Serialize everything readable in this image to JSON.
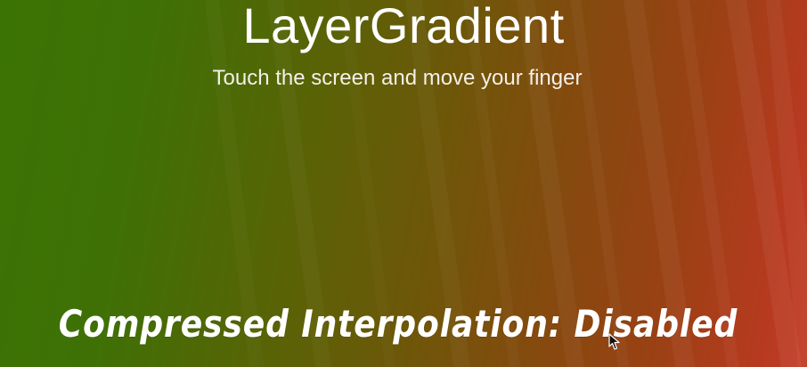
{
  "app": {
    "title": "LayerGradient",
    "instruction": "Touch the screen and move your finger",
    "status_text": "Compressed Interpolation: Disabled"
  },
  "colors": {
    "gradient_start": "#3b7404",
    "gradient_end": "#c23d26",
    "text": "#ffffff"
  },
  "icons": {
    "cursor": "mouse-pointer-icon"
  }
}
